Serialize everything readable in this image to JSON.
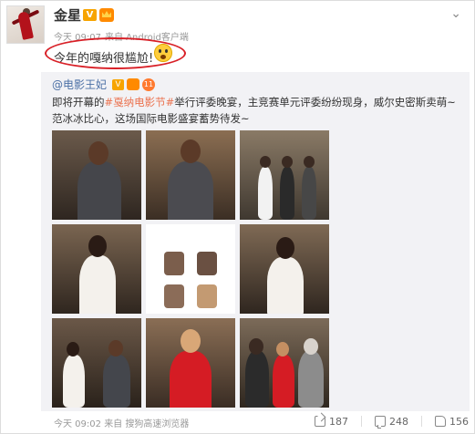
{
  "post": {
    "username": "金星",
    "v_badge": "V",
    "timestamp": "今天 09:07",
    "source": "来自 Android客户端",
    "text": "今年的嘎纳很尴尬!",
    "emoji": "surprised-face-icon"
  },
  "repost": {
    "author": "@电影王妃",
    "v_badge": "V",
    "level": "11",
    "text_prefix": "即将开幕的",
    "hashtag": "#戛纳电影节#",
    "text_suffix": "举行评委晚宴，主竞赛单元评委纷纷现身，威尔史密斯卖萌~范冰冰比心，这场国际电影盛宴蓄势待发~",
    "photo_count": 9
  },
  "footer": {
    "timestamp": "今天 09:02",
    "source": "来自 搜狗高速浏览器",
    "share_count": "187",
    "comment_count": "248",
    "like_count": "156"
  },
  "colors": {
    "link": "#4a6fa5",
    "hashtag": "#eb7350",
    "highlight_circle": "#d81f26",
    "repost_bg": "#f2f2f5"
  }
}
